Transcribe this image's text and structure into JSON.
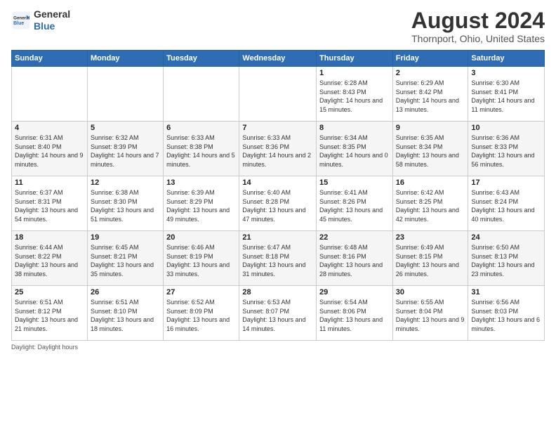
{
  "header": {
    "logo_general": "General",
    "logo_blue": "Blue",
    "month_year": "August 2024",
    "location": "Thornport, Ohio, United States"
  },
  "weekdays": [
    "Sunday",
    "Monday",
    "Tuesday",
    "Wednesday",
    "Thursday",
    "Friday",
    "Saturday"
  ],
  "weeks": [
    [
      {
        "day": "",
        "info": ""
      },
      {
        "day": "",
        "info": ""
      },
      {
        "day": "",
        "info": ""
      },
      {
        "day": "",
        "info": ""
      },
      {
        "day": "1",
        "sunrise": "6:28 AM",
        "sunset": "8:43 PM",
        "daylight": "14 hours and 15 minutes."
      },
      {
        "day": "2",
        "sunrise": "6:29 AM",
        "sunset": "8:42 PM",
        "daylight": "14 hours and 13 minutes."
      },
      {
        "day": "3",
        "sunrise": "6:30 AM",
        "sunset": "8:41 PM",
        "daylight": "14 hours and 11 minutes."
      }
    ],
    [
      {
        "day": "4",
        "sunrise": "6:31 AM",
        "sunset": "8:40 PM",
        "daylight": "14 hours and 9 minutes."
      },
      {
        "day": "5",
        "sunrise": "6:32 AM",
        "sunset": "8:39 PM",
        "daylight": "14 hours and 7 minutes."
      },
      {
        "day": "6",
        "sunrise": "6:33 AM",
        "sunset": "8:38 PM",
        "daylight": "14 hours and 5 minutes."
      },
      {
        "day": "7",
        "sunrise": "6:33 AM",
        "sunset": "8:36 PM",
        "daylight": "14 hours and 2 minutes."
      },
      {
        "day": "8",
        "sunrise": "6:34 AM",
        "sunset": "8:35 PM",
        "daylight": "14 hours and 0 minutes."
      },
      {
        "day": "9",
        "sunrise": "6:35 AM",
        "sunset": "8:34 PM",
        "daylight": "13 hours and 58 minutes."
      },
      {
        "day": "10",
        "sunrise": "6:36 AM",
        "sunset": "8:33 PM",
        "daylight": "13 hours and 56 minutes."
      }
    ],
    [
      {
        "day": "11",
        "sunrise": "6:37 AM",
        "sunset": "8:31 PM",
        "daylight": "13 hours and 54 minutes."
      },
      {
        "day": "12",
        "sunrise": "6:38 AM",
        "sunset": "8:30 PM",
        "daylight": "13 hours and 51 minutes."
      },
      {
        "day": "13",
        "sunrise": "6:39 AM",
        "sunset": "8:29 PM",
        "daylight": "13 hours and 49 minutes."
      },
      {
        "day": "14",
        "sunrise": "6:40 AM",
        "sunset": "8:28 PM",
        "daylight": "13 hours and 47 minutes."
      },
      {
        "day": "15",
        "sunrise": "6:41 AM",
        "sunset": "8:26 PM",
        "daylight": "13 hours and 45 minutes."
      },
      {
        "day": "16",
        "sunrise": "6:42 AM",
        "sunset": "8:25 PM",
        "daylight": "13 hours and 42 minutes."
      },
      {
        "day": "17",
        "sunrise": "6:43 AM",
        "sunset": "8:24 PM",
        "daylight": "13 hours and 40 minutes."
      }
    ],
    [
      {
        "day": "18",
        "sunrise": "6:44 AM",
        "sunset": "8:22 PM",
        "daylight": "13 hours and 38 minutes."
      },
      {
        "day": "19",
        "sunrise": "6:45 AM",
        "sunset": "8:21 PM",
        "daylight": "13 hours and 35 minutes."
      },
      {
        "day": "20",
        "sunrise": "6:46 AM",
        "sunset": "8:19 PM",
        "daylight": "13 hours and 33 minutes."
      },
      {
        "day": "21",
        "sunrise": "6:47 AM",
        "sunset": "8:18 PM",
        "daylight": "13 hours and 31 minutes."
      },
      {
        "day": "22",
        "sunrise": "6:48 AM",
        "sunset": "8:16 PM",
        "daylight": "13 hours and 28 minutes."
      },
      {
        "day": "23",
        "sunrise": "6:49 AM",
        "sunset": "8:15 PM",
        "daylight": "13 hours and 26 minutes."
      },
      {
        "day": "24",
        "sunrise": "6:50 AM",
        "sunset": "8:13 PM",
        "daylight": "13 hours and 23 minutes."
      }
    ],
    [
      {
        "day": "25",
        "sunrise": "6:51 AM",
        "sunset": "8:12 PM",
        "daylight": "13 hours and 21 minutes."
      },
      {
        "day": "26",
        "sunrise": "6:51 AM",
        "sunset": "8:10 PM",
        "daylight": "13 hours and 18 minutes."
      },
      {
        "day": "27",
        "sunrise": "6:52 AM",
        "sunset": "8:09 PM",
        "daylight": "13 hours and 16 minutes."
      },
      {
        "day": "28",
        "sunrise": "6:53 AM",
        "sunset": "8:07 PM",
        "daylight": "13 hours and 14 minutes."
      },
      {
        "day": "29",
        "sunrise": "6:54 AM",
        "sunset": "8:06 PM",
        "daylight": "13 hours and 11 minutes."
      },
      {
        "day": "30",
        "sunrise": "6:55 AM",
        "sunset": "8:04 PM",
        "daylight": "13 hours and 9 minutes."
      },
      {
        "day": "31",
        "sunrise": "6:56 AM",
        "sunset": "8:03 PM",
        "daylight": "13 hours and 6 minutes."
      }
    ]
  ],
  "labels": {
    "sunrise": "Sunrise:",
    "sunset": "Sunset:",
    "daylight": "Daylight:"
  }
}
